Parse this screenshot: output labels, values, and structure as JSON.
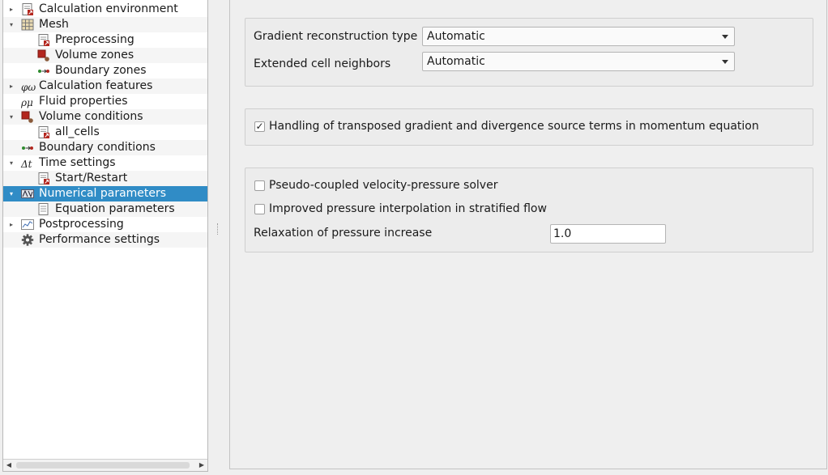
{
  "tree": {
    "items": [
      {
        "label": "Calculation environment",
        "arrow": "▸",
        "icon": "file-red-icon"
      },
      {
        "label": "Mesh",
        "arrow": "▾",
        "icon": "grid-icon"
      },
      {
        "label": "Preprocessing",
        "arrow": "",
        "icon": "file-red-icon"
      },
      {
        "label": "Volume zones",
        "arrow": "",
        "icon": "volume-zones-icon"
      },
      {
        "label": "Boundary zones",
        "arrow": "",
        "icon": "boundary-arrows-icon"
      },
      {
        "label": "Calculation features",
        "arrow": "▸",
        "icon": "phi-omega-icon",
        "icon_text": "φω"
      },
      {
        "label": "Fluid properties",
        "arrow": "",
        "icon": "rho-mu-icon",
        "icon_text": "ρμ"
      },
      {
        "label": "Volume conditions",
        "arrow": "▾",
        "icon": "volume-zones-icon"
      },
      {
        "label": "all_cells",
        "arrow": "",
        "icon": "file-red-icon"
      },
      {
        "label": "Boundary conditions",
        "arrow": "",
        "icon": "boundary-arrows-icon"
      },
      {
        "label": "Time settings",
        "arrow": "▾",
        "icon": "delta-t-icon",
        "icon_text": "Δt"
      },
      {
        "label": "Start/Restart",
        "arrow": "",
        "icon": "file-red-icon"
      },
      {
        "label": "Numerical parameters",
        "arrow": "▾",
        "icon": "numerical-icon"
      },
      {
        "label": "Equation parameters",
        "arrow": "",
        "icon": "file-plain-icon"
      },
      {
        "label": "Postprocessing",
        "arrow": "▸",
        "icon": "chart-icon"
      },
      {
        "label": "Performance settings",
        "arrow": "",
        "icon": "gear-icon"
      }
    ]
  },
  "gradient_group": {
    "gradient_label": "Gradient reconstruction type",
    "gradient_value": "Automatic",
    "neighbors_label": "Extended cell neighbors",
    "neighbors_value": "Automatic"
  },
  "transposed_group": {
    "checkbox_label": "Handling of transposed gradient and divergence source terms in momentum equation",
    "checked_mark": "✓"
  },
  "pressure_group": {
    "pseudo_label": "Pseudo-coupled velocity-pressure solver",
    "improved_label": "Improved pressure interpolation in stratified flow",
    "relaxation_label": "Relaxation of pressure increase",
    "relaxation_value": "1.0"
  },
  "colors": {
    "selection": "#308cc6",
    "icon_red": "#b3261e",
    "icon_green": "#2e8b2e"
  }
}
